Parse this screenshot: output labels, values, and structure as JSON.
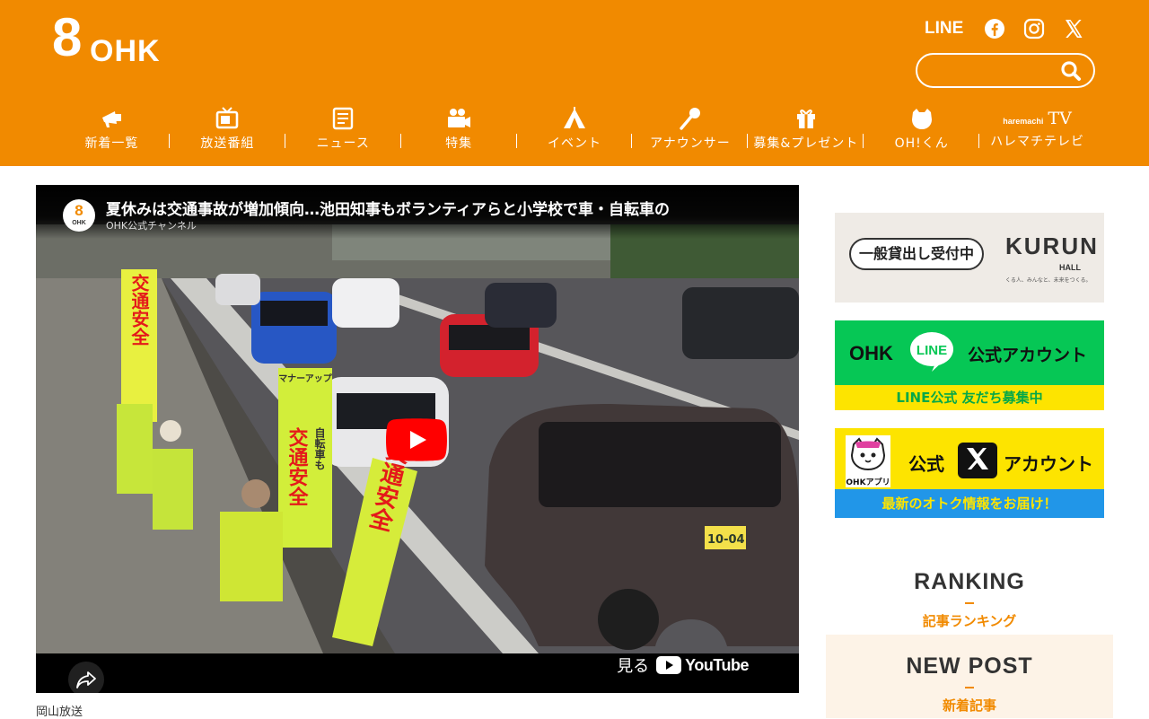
{
  "brand": {
    "logo_number": "8",
    "logo_text": "OHK",
    "accent_color": "#f18a00"
  },
  "social": {
    "line_label": "LINE",
    "icons": [
      "facebook-icon",
      "instagram-icon",
      "x-icon"
    ]
  },
  "search": {
    "placeholder": ""
  },
  "nav": [
    {
      "label": "新着一覧",
      "icon": "megaphone-icon"
    },
    {
      "label": "放送番組",
      "icon": "tv-icon"
    },
    {
      "label": "ニュース",
      "icon": "news-icon"
    },
    {
      "label": "特集",
      "icon": "camera-icon"
    },
    {
      "label": "イベント",
      "icon": "tent-icon"
    },
    {
      "label": "アナウンサー",
      "icon": "microphone-icon"
    },
    {
      "label": "募集&プレゼント",
      "icon": "gift-icon"
    },
    {
      "label": "OH!くん",
      "icon": "cat-icon"
    },
    {
      "label": "ハレマチテレビ",
      "icon": "haremachi-tv-logo",
      "logo_small": "haremachi",
      "logo_big": "TV"
    }
  ],
  "video": {
    "title": "夏休みは交通事故が増加傾向…池田知事もボランティアらと小学校で車・自転車の",
    "channel": "OHK公式チャンネル",
    "avatar_number": "8",
    "avatar_text": "OHK",
    "watch_on": "見る",
    "youtube_word": "YouTube",
    "scene_banners": [
      "交通安全",
      "自転車も",
      "交通安全",
      "マナーアップ"
    ],
    "plate": "10-04"
  },
  "caption": "岡山放送",
  "sidebar": {
    "kurun": {
      "bubble": "一般貸出し受付中",
      "logo": "KURUN",
      "hall": "HALL",
      "tagline": "くる人、みんなと、未来をつくる。"
    },
    "line": {
      "ohk": "OHK",
      "line_word": "LINE",
      "account": "公式アカウント",
      "strip": "LINE公式 友だち募集中"
    },
    "x": {
      "app": "OHKアプリ",
      "koshiki": "公式",
      "account": "アカウント",
      "strip": "最新のオトク情報をお届け！"
    },
    "ranking": {
      "en": "RANKING",
      "ja": "記事ランキング"
    },
    "newpost": {
      "en": "NEW POST",
      "ja": "新着記事"
    }
  }
}
